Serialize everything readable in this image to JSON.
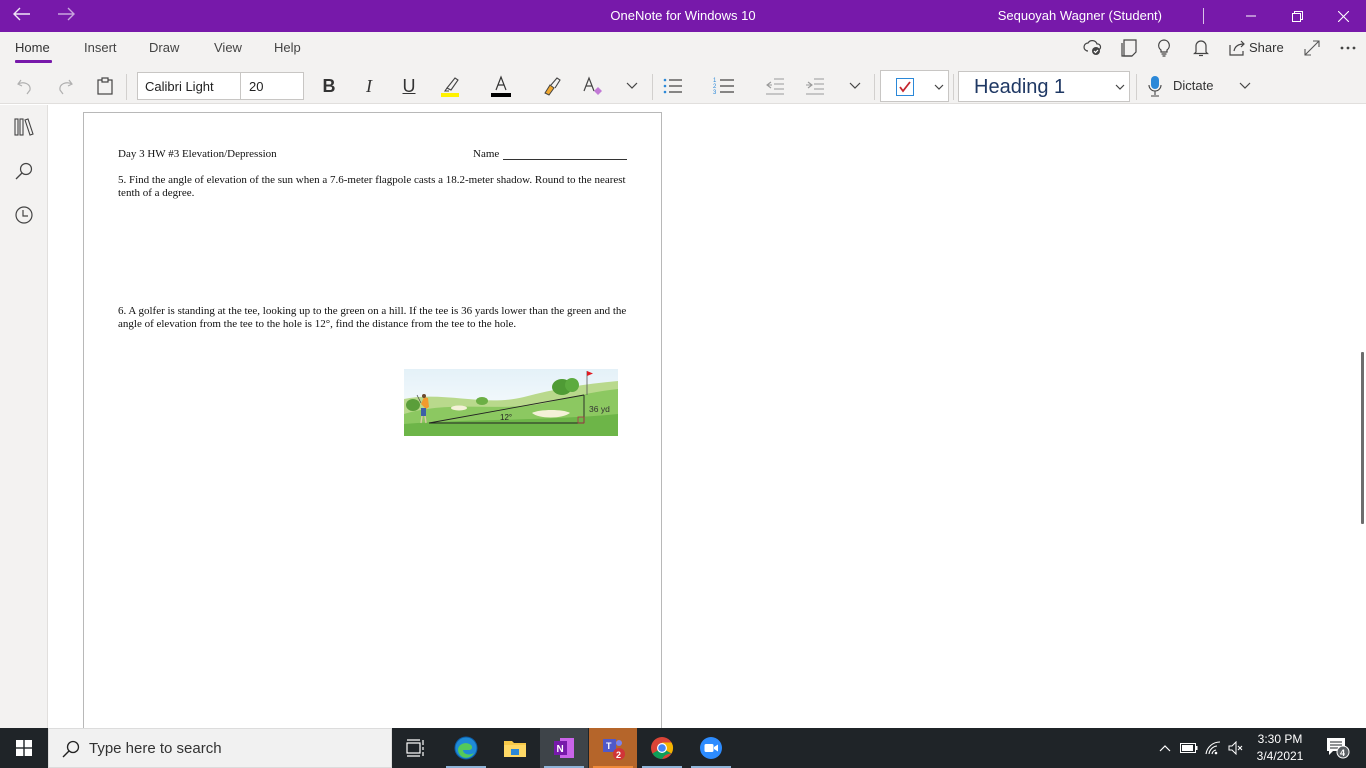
{
  "titlebar": {
    "back_icon": "arrow-left-icon",
    "forward_icon": "arrow-right-icon",
    "title": "OneNote for Windows 10",
    "user": "Sequoyah Wagner (Student)",
    "minimize_icon": "minimize-icon",
    "restore_icon": "restore-icon",
    "close_icon": "close-icon"
  },
  "ribbon": {
    "tabs": [
      {
        "label": "Home",
        "active": true
      },
      {
        "label": "Insert",
        "active": false
      },
      {
        "label": "Draw",
        "active": false
      },
      {
        "label": "View",
        "active": false
      },
      {
        "label": "Help",
        "active": false
      }
    ],
    "right": {
      "sync_icon": "cloud-sync-icon",
      "notes_icon": "sticky-notes-icon",
      "ideas_icon": "lightbulb-icon",
      "notifications_icon": "bell-icon",
      "share_label": "Share",
      "fullscreen_icon": "expand-icon",
      "more_icon": "more-icon"
    },
    "toolbar": {
      "font_name": "Calibri Light",
      "font_size": "20",
      "style": "Heading 1",
      "dictate_label": "Dictate",
      "highlight_color": "#fff200",
      "font_color": "#000000"
    }
  },
  "rail": {
    "items": [
      "notebooks-icon",
      "search-icon",
      "recent-icon"
    ]
  },
  "document": {
    "heading": "Day 3 HW #3  Elevation/Depression",
    "name_label": "Name",
    "q5": "5. Find the angle of elevation of the sun when a 7.6-meter flagpole casts a 18.2-meter shadow. Round to the nearest tenth of a degree.",
    "q6": "6. A golfer is standing at the tee, looking up to the green on a hill. If the tee is 36 yards lower than the green and the angle of elevation from the tee to the hole is 12°, find the distance from the tee to the hole.",
    "figure": {
      "angle_label": "12°",
      "height_label": "36 yd"
    }
  },
  "taskbar": {
    "search_placeholder": "Type here to search",
    "apps": [
      "task-view",
      "edge",
      "file-explorer",
      "onenote",
      "teams",
      "chrome",
      "zoom"
    ],
    "teams_badge": "2",
    "time": "3:30 PM",
    "date": "3/4/2021",
    "notifications_count": "4"
  }
}
